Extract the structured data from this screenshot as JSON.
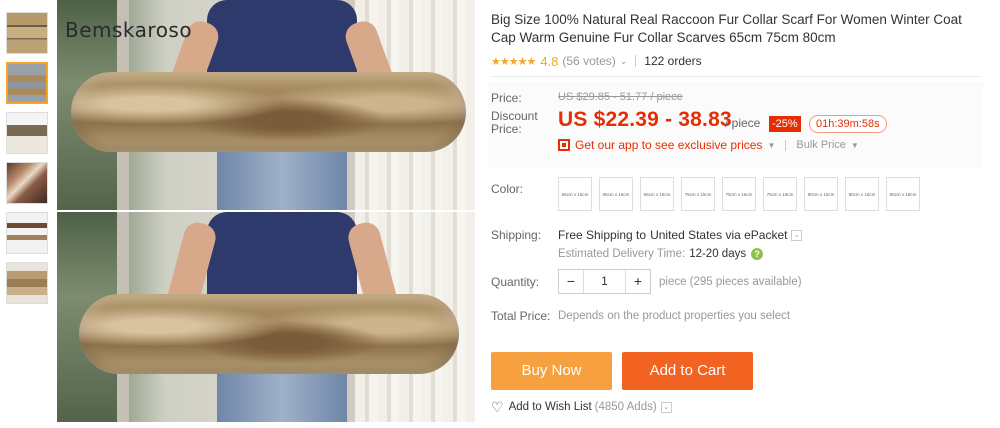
{
  "product": {
    "title": "Big Size 100% Natural Real Raccoon Fur Collar Scarf For Women Winter Coat Cap Warm Genuine Fur Collar Scarves 65cm 75cm 80cm",
    "watermark": "Bemskaroso",
    "rating": {
      "stars": "★★★★★",
      "value": "4.8",
      "reviews": "(56 votes)",
      "orders": "122 orders"
    }
  },
  "price": {
    "label": "Price:",
    "original": "US $29.85 - 51.77 / piece",
    "discount_label_1": "Discount",
    "discount_label_2": "Price:",
    "discount": "US $22.39 - 38.83",
    "unit": "/ piece",
    "badge": "-25%",
    "timer": "01h:39m:58s",
    "app_promo": "Get our app to see exclusive prices",
    "bulk": "Bulk Price"
  },
  "color": {
    "label": "Color:",
    "options": [
      "65cm x 15cm",
      "65cm x 16cm",
      "65cm x 18cm",
      "75cm x 15cm",
      "75cm x 16cm",
      "75cm x 18cm",
      "80cm x 15cm",
      "80cm x 16cm",
      "80cm x 18cm"
    ]
  },
  "shipping": {
    "label": "Shipping:",
    "free": "Free Shipping to",
    "via": "United States via ePacket",
    "est_label": "Estimated Delivery Time:",
    "est_days": "12-20 days"
  },
  "quantity": {
    "label": "Quantity:",
    "minus": "−",
    "value": "1",
    "plus": "+",
    "available": "piece (295 pieces available)"
  },
  "total": {
    "label": "Total Price:",
    "value": "Depends on the product properties you select"
  },
  "actions": {
    "buy_now": "Buy Now",
    "add_to_cart": "Add to Cart",
    "wishlist": "Add to Wish List",
    "wishlist_count": "(4850 Adds)"
  },
  "colors": {
    "accent": "#e62e04",
    "buy": "#f6a03f",
    "cart": "#f26322",
    "star": "#f5a623"
  }
}
